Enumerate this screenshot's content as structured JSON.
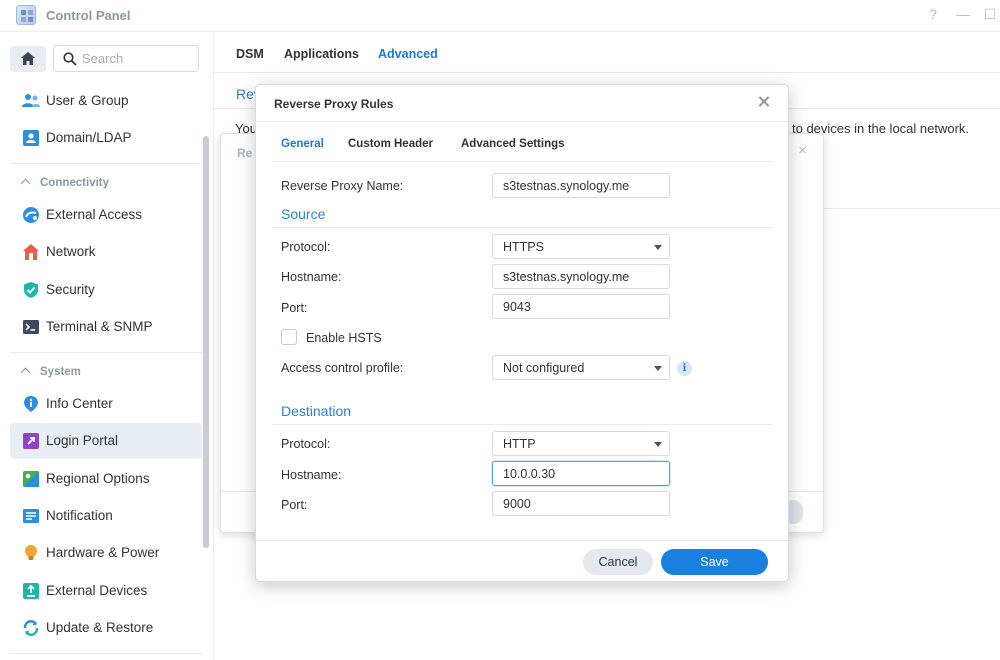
{
  "window": {
    "title": "Control Panel",
    "help_glyph": "?",
    "minimize_glyph": "—",
    "maximize_glyph": "☐"
  },
  "sidebar": {
    "search_placeholder": "Search",
    "items_top": [
      {
        "label": "User & Group",
        "icon": "users-icon"
      },
      {
        "label": "Domain/LDAP",
        "icon": "domain-icon"
      }
    ],
    "connectivity": {
      "heading": "Connectivity",
      "items": [
        {
          "label": "External Access",
          "icon": "external-access-icon"
        },
        {
          "label": "Network",
          "icon": "network-icon"
        },
        {
          "label": "Security",
          "icon": "shield-icon"
        },
        {
          "label": "Terminal & SNMP",
          "icon": "terminal-icon"
        }
      ]
    },
    "system": {
      "heading": "System",
      "items": [
        {
          "label": "Info Center",
          "icon": "info-icon"
        },
        {
          "label": "Login Portal",
          "icon": "login-portal-icon",
          "active": true
        },
        {
          "label": "Regional Options",
          "icon": "regional-icon"
        },
        {
          "label": "Notification",
          "icon": "notification-icon"
        },
        {
          "label": "Hardware & Power",
          "icon": "bulb-icon"
        },
        {
          "label": "External Devices",
          "icon": "external-devices-icon"
        },
        {
          "label": "Update & Restore",
          "icon": "update-icon"
        }
      ]
    }
  },
  "main": {
    "tabs": [
      {
        "label": "DSM"
      },
      {
        "label": "Applications"
      },
      {
        "label": "Advanced",
        "active": true
      }
    ],
    "bg_heading": "Rev",
    "bg_desc_left": "You",
    "bg_desc_right": "to devices in the local network.",
    "under_dialog_title": "Re",
    "under_dialog_close": "×"
  },
  "modal": {
    "title": "Reverse Proxy Rules",
    "tabs": [
      {
        "label": "General",
        "active": true
      },
      {
        "label": "Custom Header"
      },
      {
        "label": "Advanced Settings"
      }
    ],
    "name_label": "Reverse Proxy Name:",
    "name_value": "s3testnas.synology.me",
    "source": {
      "title": "Source",
      "protocol_label": "Protocol:",
      "protocol_value": "HTTPS",
      "hostname_label": "Hostname:",
      "hostname_value": "s3testnas.synology.me",
      "port_label": "Port:",
      "port_value": "9043",
      "hsts_label": "Enable HSTS",
      "hsts_checked": false,
      "acl_label": "Access control profile:",
      "acl_value": "Not configured",
      "info_glyph": "i"
    },
    "destination": {
      "title": "Destination",
      "protocol_label": "Protocol:",
      "protocol_value": "HTTP",
      "hostname_label": "Hostname:",
      "hostname_value": "10.0.0.30",
      "port_label": "Port:",
      "port_value": "9000"
    },
    "cancel_label": "Cancel",
    "save_label": "Save"
  },
  "colors": {
    "accent": "#1d78d1",
    "save_button": "#1a80e0",
    "section_title": "#2b7fd3"
  }
}
